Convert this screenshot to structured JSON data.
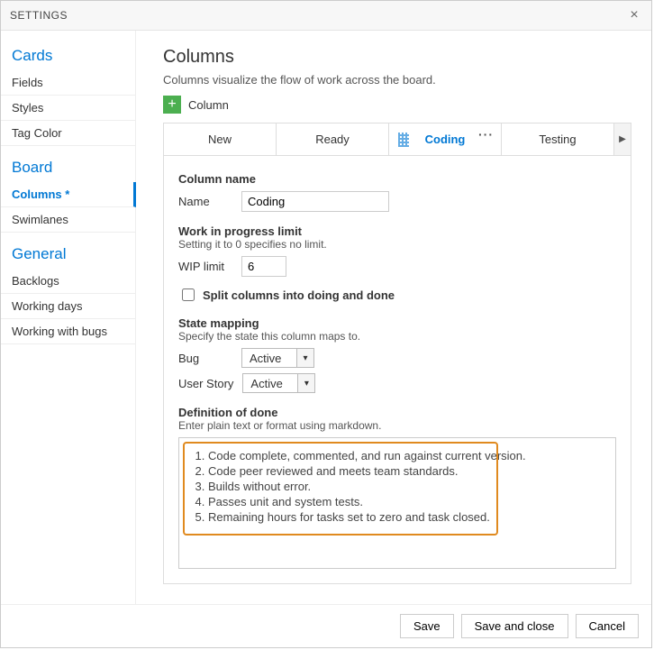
{
  "header": {
    "title": "SETTINGS"
  },
  "sidebar": {
    "groups": [
      {
        "title": "Cards",
        "items": [
          {
            "label": "Fields"
          },
          {
            "label": "Styles"
          },
          {
            "label": "Tag Color"
          }
        ]
      },
      {
        "title": "Board",
        "items": [
          {
            "label": "Columns *",
            "selected": true
          },
          {
            "label": "Swimlanes"
          }
        ]
      },
      {
        "title": "General",
        "items": [
          {
            "label": "Backlogs"
          },
          {
            "label": "Working days"
          },
          {
            "label": "Working with bugs"
          }
        ]
      }
    ]
  },
  "main": {
    "heading": "Columns",
    "subtitle": "Columns visualize the flow of work across the board.",
    "add_label": "Column",
    "tabs": [
      {
        "label": "New"
      },
      {
        "label": "Ready"
      },
      {
        "label": "Coding",
        "selected": true
      },
      {
        "label": "Testing"
      }
    ],
    "column_name": {
      "title": "Column name",
      "label": "Name",
      "value": "Coding"
    },
    "wip": {
      "title": "Work in progress limit",
      "sub": "Setting it to 0 specifies no limit.",
      "label": "WIP limit",
      "value": "6"
    },
    "split": {
      "label": "Split columns into doing and done",
      "checked": false
    },
    "state_mapping": {
      "title": "State mapping",
      "sub": "Specify the state this column maps to.",
      "rows": [
        {
          "label": "Bug",
          "value": "Active"
        },
        {
          "label": "User Story",
          "value": "Active"
        }
      ]
    },
    "dod": {
      "title": "Definition of done",
      "sub": "Enter plain text or format using markdown.",
      "items": [
        "Code complete, commented, and run against current version.",
        "Code peer reviewed and meets team standards.",
        "Builds without error.",
        "Passes unit and system tests.",
        "Remaining hours for tasks set to zero and task closed."
      ]
    }
  },
  "footer": {
    "save": "Save",
    "save_close": "Save and close",
    "cancel": "Cancel"
  }
}
